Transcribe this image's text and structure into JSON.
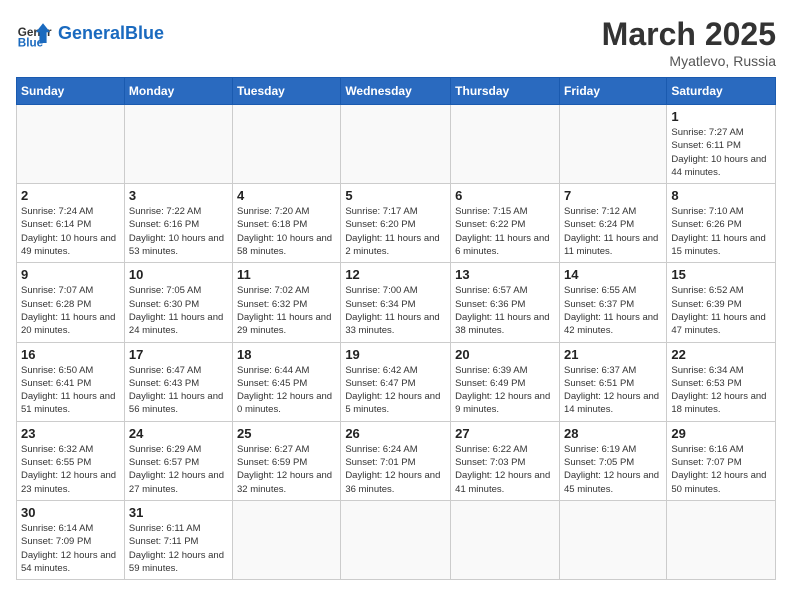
{
  "header": {
    "logo_general": "General",
    "logo_blue": "Blue",
    "title": "March 2025",
    "subtitle": "Myatlevo, Russia"
  },
  "weekdays": [
    "Sunday",
    "Monday",
    "Tuesday",
    "Wednesday",
    "Thursday",
    "Friday",
    "Saturday"
  ],
  "weeks": [
    [
      {
        "day": "",
        "info": ""
      },
      {
        "day": "",
        "info": ""
      },
      {
        "day": "",
        "info": ""
      },
      {
        "day": "",
        "info": ""
      },
      {
        "day": "",
        "info": ""
      },
      {
        "day": "",
        "info": ""
      },
      {
        "day": "1",
        "info": "Sunrise: 7:27 AM\nSunset: 6:11 PM\nDaylight: 10 hours and 44 minutes."
      }
    ],
    [
      {
        "day": "2",
        "info": "Sunrise: 7:24 AM\nSunset: 6:14 PM\nDaylight: 10 hours and 49 minutes."
      },
      {
        "day": "3",
        "info": "Sunrise: 7:22 AM\nSunset: 6:16 PM\nDaylight: 10 hours and 53 minutes."
      },
      {
        "day": "4",
        "info": "Sunrise: 7:20 AM\nSunset: 6:18 PM\nDaylight: 10 hours and 58 minutes."
      },
      {
        "day": "5",
        "info": "Sunrise: 7:17 AM\nSunset: 6:20 PM\nDaylight: 11 hours and 2 minutes."
      },
      {
        "day": "6",
        "info": "Sunrise: 7:15 AM\nSunset: 6:22 PM\nDaylight: 11 hours and 6 minutes."
      },
      {
        "day": "7",
        "info": "Sunrise: 7:12 AM\nSunset: 6:24 PM\nDaylight: 11 hours and 11 minutes."
      },
      {
        "day": "8",
        "info": "Sunrise: 7:10 AM\nSunset: 6:26 PM\nDaylight: 11 hours and 15 minutes."
      }
    ],
    [
      {
        "day": "9",
        "info": "Sunrise: 7:07 AM\nSunset: 6:28 PM\nDaylight: 11 hours and 20 minutes."
      },
      {
        "day": "10",
        "info": "Sunrise: 7:05 AM\nSunset: 6:30 PM\nDaylight: 11 hours and 24 minutes."
      },
      {
        "day": "11",
        "info": "Sunrise: 7:02 AM\nSunset: 6:32 PM\nDaylight: 11 hours and 29 minutes."
      },
      {
        "day": "12",
        "info": "Sunrise: 7:00 AM\nSunset: 6:34 PM\nDaylight: 11 hours and 33 minutes."
      },
      {
        "day": "13",
        "info": "Sunrise: 6:57 AM\nSunset: 6:36 PM\nDaylight: 11 hours and 38 minutes."
      },
      {
        "day": "14",
        "info": "Sunrise: 6:55 AM\nSunset: 6:37 PM\nDaylight: 11 hours and 42 minutes."
      },
      {
        "day": "15",
        "info": "Sunrise: 6:52 AM\nSunset: 6:39 PM\nDaylight: 11 hours and 47 minutes."
      }
    ],
    [
      {
        "day": "16",
        "info": "Sunrise: 6:50 AM\nSunset: 6:41 PM\nDaylight: 11 hours and 51 minutes."
      },
      {
        "day": "17",
        "info": "Sunrise: 6:47 AM\nSunset: 6:43 PM\nDaylight: 11 hours and 56 minutes."
      },
      {
        "day": "18",
        "info": "Sunrise: 6:44 AM\nSunset: 6:45 PM\nDaylight: 12 hours and 0 minutes."
      },
      {
        "day": "19",
        "info": "Sunrise: 6:42 AM\nSunset: 6:47 PM\nDaylight: 12 hours and 5 minutes."
      },
      {
        "day": "20",
        "info": "Sunrise: 6:39 AM\nSunset: 6:49 PM\nDaylight: 12 hours and 9 minutes."
      },
      {
        "day": "21",
        "info": "Sunrise: 6:37 AM\nSunset: 6:51 PM\nDaylight: 12 hours and 14 minutes."
      },
      {
        "day": "22",
        "info": "Sunrise: 6:34 AM\nSunset: 6:53 PM\nDaylight: 12 hours and 18 minutes."
      }
    ],
    [
      {
        "day": "23",
        "info": "Sunrise: 6:32 AM\nSunset: 6:55 PM\nDaylight: 12 hours and 23 minutes."
      },
      {
        "day": "24",
        "info": "Sunrise: 6:29 AM\nSunset: 6:57 PM\nDaylight: 12 hours and 27 minutes."
      },
      {
        "day": "25",
        "info": "Sunrise: 6:27 AM\nSunset: 6:59 PM\nDaylight: 12 hours and 32 minutes."
      },
      {
        "day": "26",
        "info": "Sunrise: 6:24 AM\nSunset: 7:01 PM\nDaylight: 12 hours and 36 minutes."
      },
      {
        "day": "27",
        "info": "Sunrise: 6:22 AM\nSunset: 7:03 PM\nDaylight: 12 hours and 41 minutes."
      },
      {
        "day": "28",
        "info": "Sunrise: 6:19 AM\nSunset: 7:05 PM\nDaylight: 12 hours and 45 minutes."
      },
      {
        "day": "29",
        "info": "Sunrise: 6:16 AM\nSunset: 7:07 PM\nDaylight: 12 hours and 50 minutes."
      }
    ],
    [
      {
        "day": "30",
        "info": "Sunrise: 6:14 AM\nSunset: 7:09 PM\nDaylight: 12 hours and 54 minutes."
      },
      {
        "day": "31",
        "info": "Sunrise: 6:11 AM\nSunset: 7:11 PM\nDaylight: 12 hours and 59 minutes."
      },
      {
        "day": "",
        "info": ""
      },
      {
        "day": "",
        "info": ""
      },
      {
        "day": "",
        "info": ""
      },
      {
        "day": "",
        "info": ""
      },
      {
        "day": "",
        "info": ""
      }
    ]
  ]
}
